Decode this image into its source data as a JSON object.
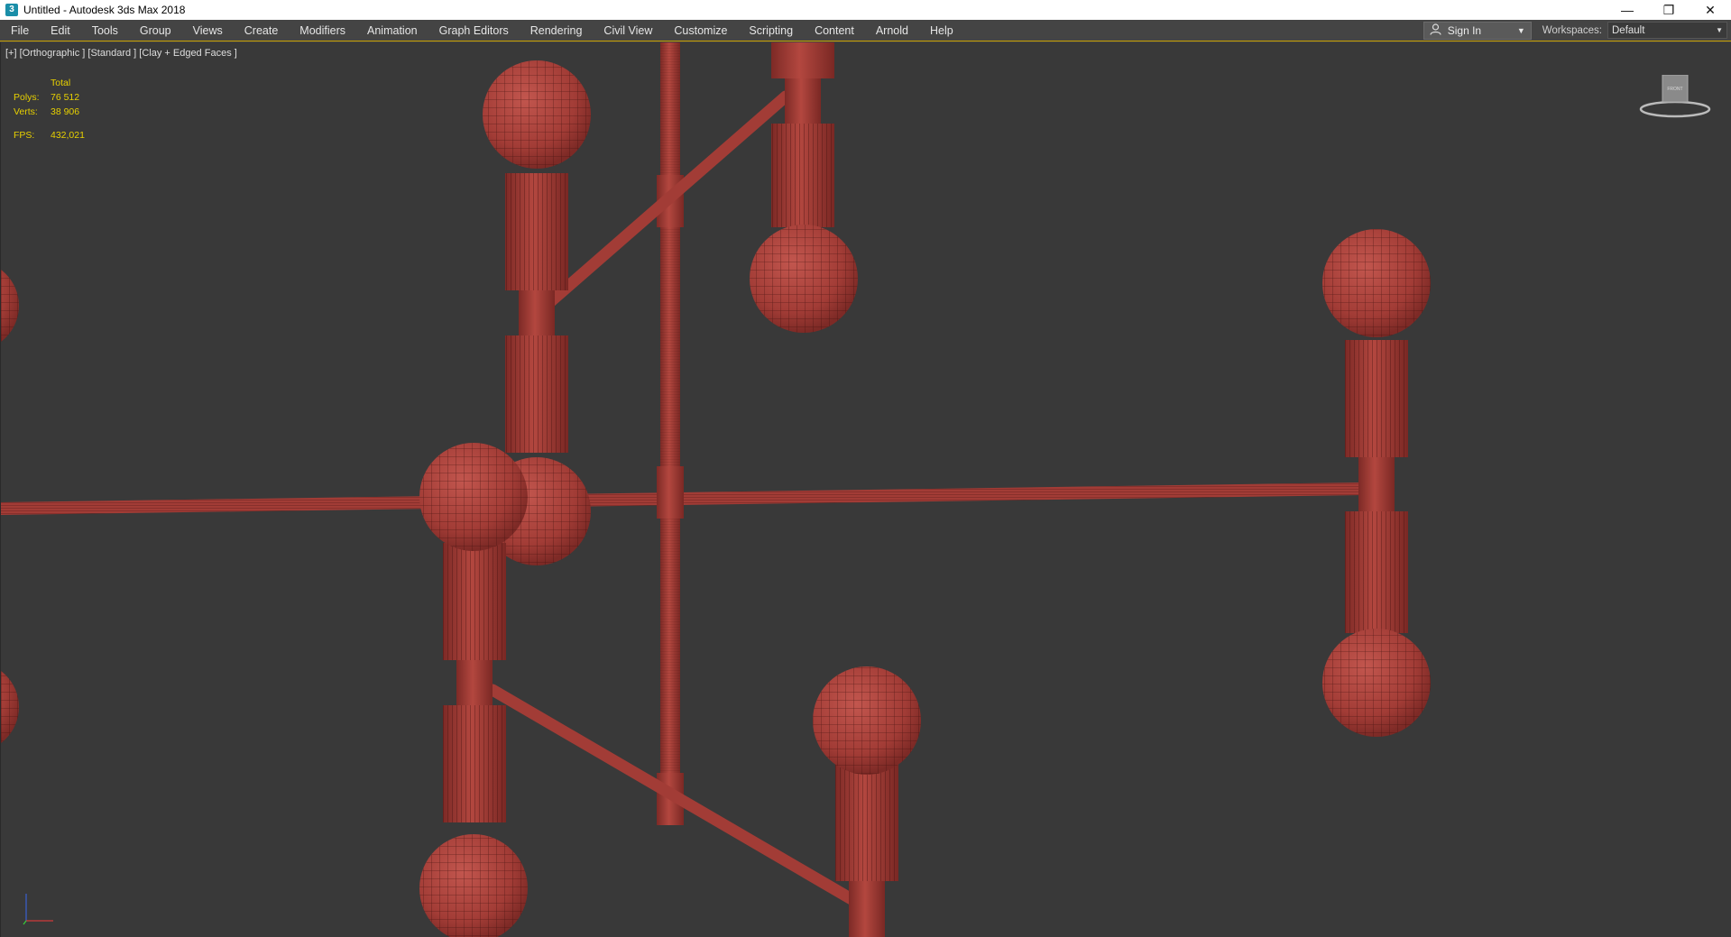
{
  "window": {
    "title": "Untitled - Autodesk 3ds Max 2018",
    "app_icon": "3",
    "controls": [
      "minimize-icon",
      "restore-icon",
      "close-icon"
    ]
  },
  "menu": {
    "items": [
      "File",
      "Edit",
      "Tools",
      "Group",
      "Views",
      "Create",
      "Modifiers",
      "Animation",
      "Graph Editors",
      "Rendering",
      "Civil View",
      "Customize",
      "Scripting",
      "Content",
      "Arnold",
      "Help"
    ],
    "sign_in": "Sign In",
    "workspaces_label": "Workspaces:",
    "workspace_value": "Default"
  },
  "viewport": {
    "label": "[+] [Orthographic ] [Standard ] [Clay + Edged Faces ]",
    "stats": {
      "total_label": "Total",
      "polys_label": "Polys:",
      "polys_value": "76 512",
      "verts_label": "Verts:",
      "verts_value": "38 906",
      "fps_label": "FPS:",
      "fps_value": "432,021"
    },
    "viewcube_face": "FRONT"
  },
  "colors": {
    "viewport_bg": "#393939",
    "model": "#a8403a",
    "stats_text": "#e8d100",
    "accent_line": "#c8a000"
  }
}
